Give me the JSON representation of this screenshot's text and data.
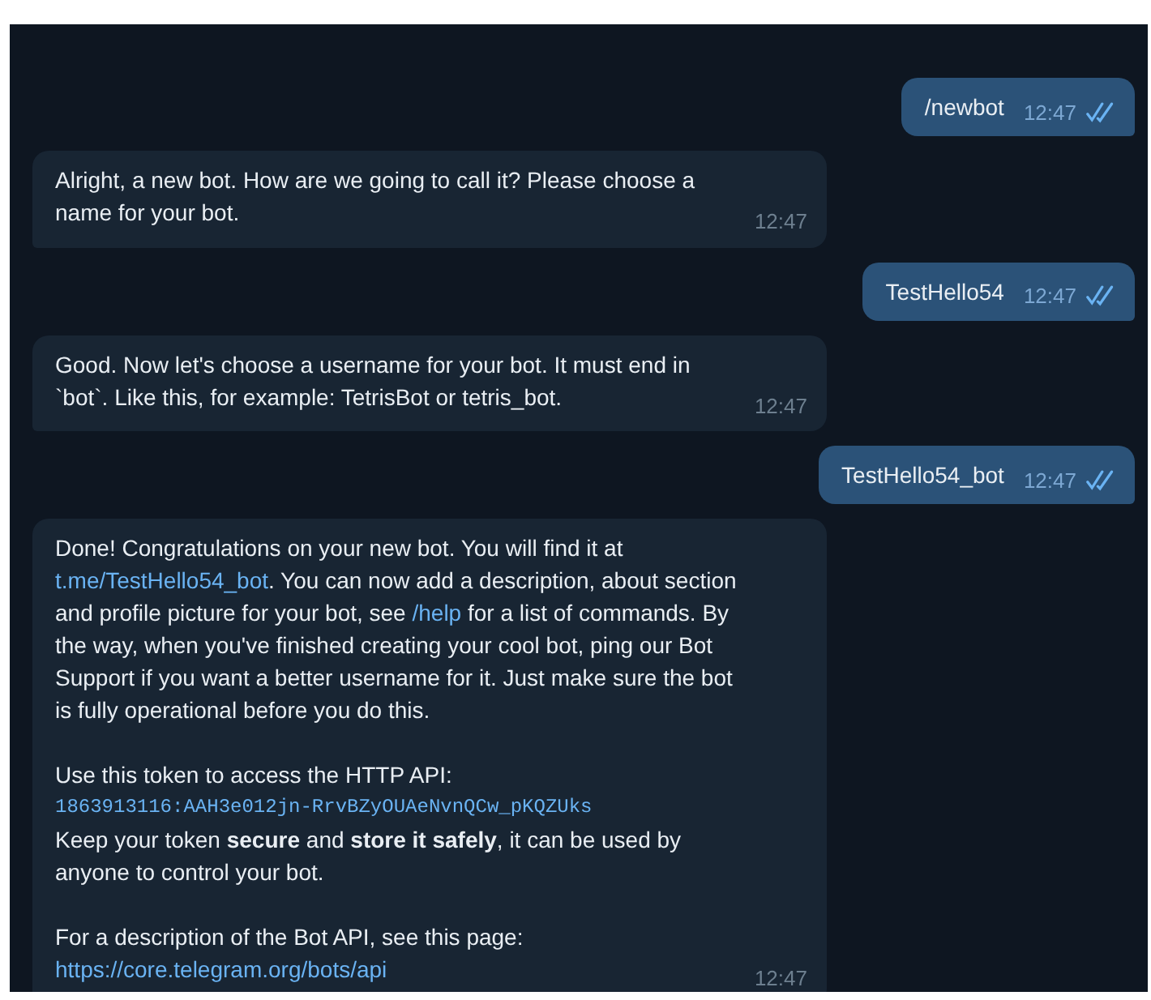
{
  "messages": [
    {
      "kind": "outgoing",
      "text": "/newbot",
      "time": "12:47",
      "read": true
    },
    {
      "kind": "incoming",
      "groups": [
        [
          {
            "kind": "text",
            "segments": [
              {
                "kind": "text",
                "text": "Alright, a new bot. How are we going to call it? Please choose a name for your bot."
              }
            ]
          }
        ]
      ],
      "time": "12:47"
    },
    {
      "kind": "outgoing",
      "text": "TestHello54",
      "time": "12:47",
      "read": true
    },
    {
      "kind": "incoming",
      "groups": [
        [
          {
            "kind": "text",
            "segments": [
              {
                "kind": "text",
                "text": "Good. Now let's choose a username for your bot. It must end in `bot`. Like this, for example: TetrisBot or tetris_bot."
              }
            ]
          }
        ]
      ],
      "time": "12:47"
    },
    {
      "kind": "outgoing",
      "text": "TestHello54_bot",
      "time": "12:47",
      "read": true
    },
    {
      "kind": "incoming",
      "groups": [
        [
          {
            "kind": "text",
            "segments": [
              {
                "kind": "text",
                "text": "Done! Congratulations on your new bot. You will find it at "
              },
              {
                "kind": "link",
                "text": "t.me/TestHello54_bot"
              },
              {
                "kind": "text",
                "text": ". You can now add a description, about section and profile picture for your bot, see "
              },
              {
                "kind": "link",
                "text": "/help"
              },
              {
                "kind": "text",
                "text": " for a list of commands. By the way, when you've finished creating your cool bot, ping our Bot Support if you want a better username for it. Just make sure the bot is fully operational before you do this."
              }
            ]
          }
        ],
        [
          {
            "kind": "text",
            "segments": [
              {
                "kind": "text",
                "text": "Use this token to access the HTTP API:"
              }
            ]
          },
          {
            "kind": "code",
            "text": "1863913116:AAH3e012jn-RrvBZyOUAeNvnQCw_pKQZUks"
          },
          {
            "kind": "text",
            "segments": [
              {
                "kind": "text",
                "text": "Keep your token **secure** and **store it safely**, it can be used by anyone to control your bot."
              }
            ]
          }
        ],
        [
          {
            "kind": "text",
            "segments": [
              {
                "kind": "text",
                "text": "For a description of the Bot API, see this page:"
              }
            ]
          },
          {
            "kind": "text",
            "segments": [
              {
                "kind": "link",
                "text": "https://core.telegram.org/bots/api"
              }
            ]
          }
        ]
      ],
      "time": "12:47"
    }
  ]
}
